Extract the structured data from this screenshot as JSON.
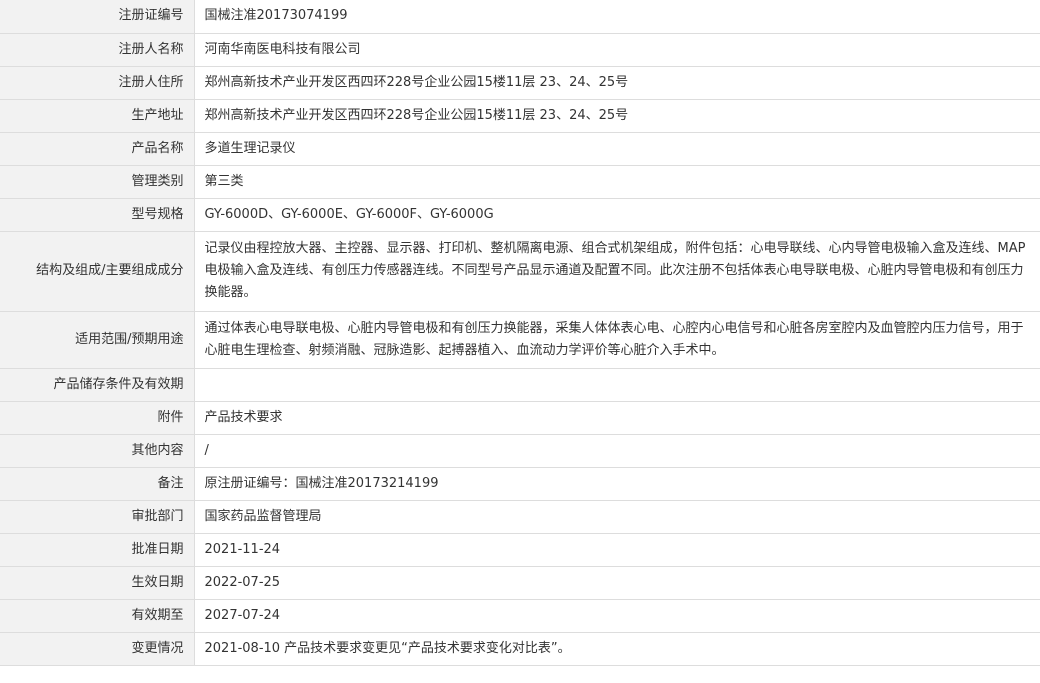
{
  "rows": [
    {
      "label": "注册证编号",
      "value": "国械注准20173074199"
    },
    {
      "label": "注册人名称",
      "value": "河南华南医电科技有限公司"
    },
    {
      "label": "注册人住所",
      "value": "郑州高新技术产业开发区西四环228号企业公园15楼11层 23、24、25号"
    },
    {
      "label": "生产地址",
      "value": "郑州高新技术产业开发区西四环228号企业公园15楼11层 23、24、25号"
    },
    {
      "label": "产品名称",
      "value": "多道生理记录仪"
    },
    {
      "label": "管理类别",
      "value": "第三类"
    },
    {
      "label": "型号规格",
      "value": "GY-6000D、GY-6000E、GY-6000F、GY-6000G"
    },
    {
      "label": "结构及组成/主要组成成分",
      "value": "记录仪由程控放大器、主控器、显示器、打印机、整机隔离电源、组合式机架组成，附件包括：心电导联线、心内导管电极输入盒及连线、MAP电极输入盒及连线、有创压力传感器连线。不同型号产品显示通道及配置不同。此次注册不包括体表心电导联电极、心脏内导管电极和有创压力换能器。"
    },
    {
      "label": "适用范围/预期用途",
      "value": "通过体表心电导联电极、心脏内导管电极和有创压力换能器，采集人体体表心电、心腔内心电信号和心脏各房室腔内及血管腔内压力信号，用于心脏电生理检查、射频消融、冠脉造影、起搏器植入、血流动力学评价等心脏介入手术中。"
    },
    {
      "label": "产品储存条件及有效期",
      "value": ""
    },
    {
      "label": "附件",
      "value": "产品技术要求"
    },
    {
      "label": "其他内容",
      "value": "/"
    },
    {
      "label": "备注",
      "value": "原注册证编号：国械注准20173214199"
    },
    {
      "label": "审批部门",
      "value": "国家药品监督管理局"
    },
    {
      "label": "批准日期",
      "value": "2021-11-24"
    },
    {
      "label": "生效日期",
      "value": "2022-07-25"
    },
    {
      "label": "有效期至",
      "value": "2027-07-24"
    },
    {
      "label": "变更情况",
      "value": "2021-08-10 产品技术要求变更见“产品技术要求变化对比表”。"
    }
  ]
}
